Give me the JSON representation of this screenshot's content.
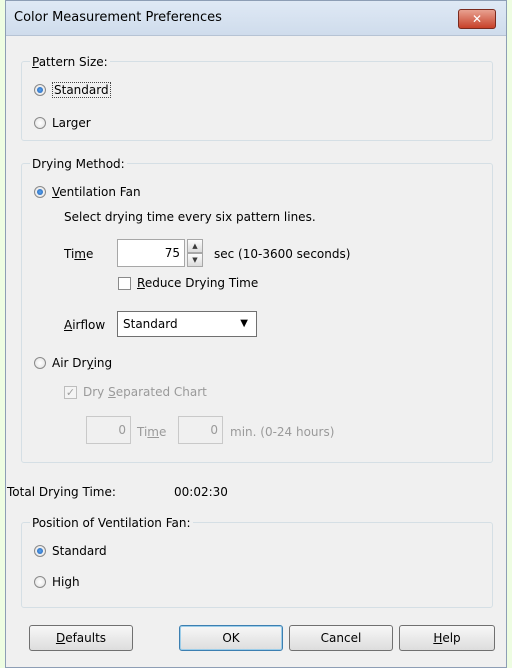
{
  "window": {
    "title": "Color Measurement Preferences",
    "close_glyph": "✕"
  },
  "pattern_size": {
    "legend_prefix": "",
    "legend_u": "P",
    "legend_rest": "attern Size:",
    "standard_label": "Standard",
    "larger_label": "Larger",
    "selected": "standard"
  },
  "drying_method": {
    "legend": "Drying Method:",
    "ventilation_fan": {
      "u": "V",
      "rest": "entilation Fan",
      "selected": true
    },
    "instruction": "Select drying time every six pattern lines.",
    "time": {
      "label_pre": "Ti",
      "label_u": "m",
      "label_post": "e",
      "value": "75",
      "units": "sec (10-3600 seconds)"
    },
    "reduce_drying": {
      "u": "R",
      "rest": "educe Drying Time",
      "checked": false
    },
    "airflow": {
      "label_u": "A",
      "label_rest": "irflow",
      "value": "Standard"
    },
    "air_drying": {
      "pre": "Air Dr",
      "u": "y",
      "post": "ing",
      "selected": false
    },
    "dry_separated": {
      "pre": "Dry ",
      "u": "S",
      "post": "eparated Chart",
      "checked": true
    },
    "air_time": {
      "left_value": "0",
      "label_pre": "Ti",
      "label_u": "m",
      "label_post": "e",
      "right_value": "0",
      "units": "min.  (0-24 hours)"
    }
  },
  "total_drying": {
    "label": "Total Drying Time:",
    "value": "00:02:30"
  },
  "fan_position": {
    "legend": "Position of Ventilation Fan:",
    "standard_label": "Standard",
    "high_label": "High",
    "selected": "standard"
  },
  "buttons": {
    "defaults": {
      "u": "D",
      "rest": "efaults"
    },
    "ok": "OK",
    "cancel": "Cancel",
    "help": {
      "u": "H",
      "rest": "elp"
    }
  },
  "icons": {
    "radio": "radio-icon",
    "checkbox": "checkbox-icon",
    "spin_up": "▲",
    "spin_down": "▼",
    "dropdown": "▼",
    "check_mark": "✓"
  }
}
